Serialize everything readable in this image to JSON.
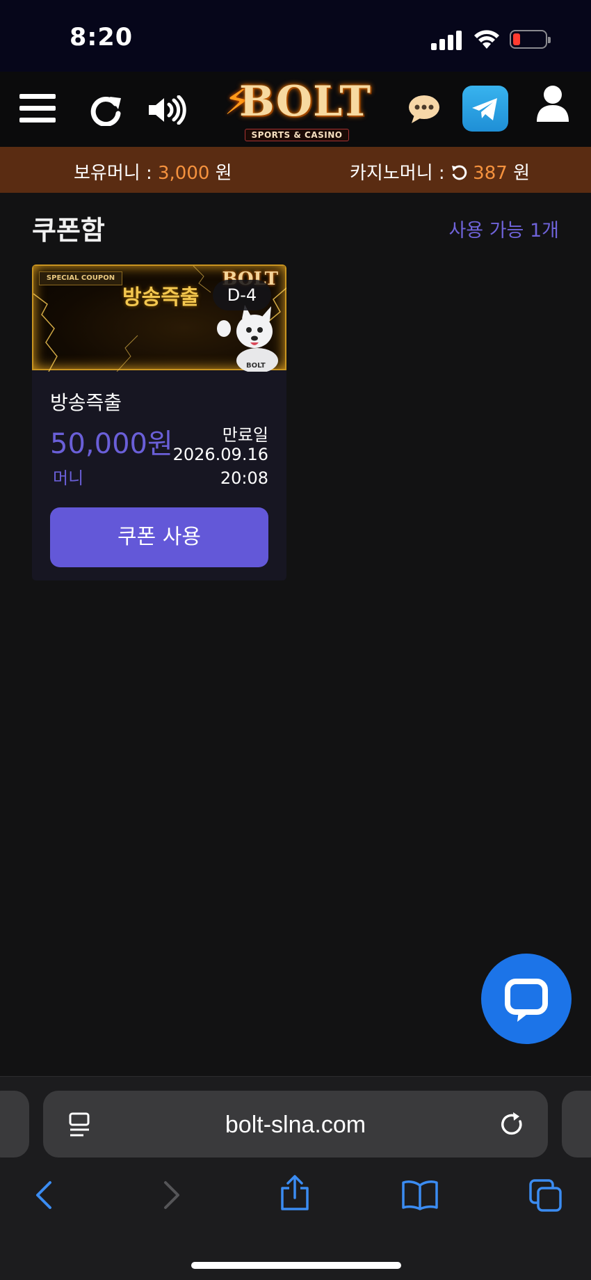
{
  "status_bar": {
    "time": "8:20"
  },
  "header": {
    "logo_text": "BOLT",
    "logo_subtitle": "SPORTS & CASINO",
    "icons": [
      "menu-icon",
      "refresh-icon",
      "sound-icon",
      "chat-bubble-icon",
      "telegram-icon",
      "user-icon"
    ]
  },
  "balance": {
    "money_label": "보유머니 : ",
    "money_value": "3,000",
    "money_unit": " 원",
    "casino_label": "카지노머니 : ",
    "casino_value": "387",
    "casino_unit": " 원"
  },
  "page": {
    "title": "쿠폰함",
    "available": "사용 가능 1개"
  },
  "coupon": {
    "banner_tag": "SPECIAL COUPON",
    "banner_title": "방송즉출",
    "banner_logo": "BOLT",
    "dday": "D-4",
    "name": "방송즉출",
    "amount": "50,000원",
    "type": "머니",
    "expiry_label": "만료일",
    "expiry_date": "2026.09.16",
    "expiry_time": "20:08",
    "button_label": "쿠폰 사용"
  },
  "browser": {
    "url": "bolt-slna.com"
  },
  "colors": {
    "accent": "#6358d8",
    "balance_bar": "#5a2c12",
    "amount": "#f5923e",
    "chat_fab": "#1c74e8"
  }
}
